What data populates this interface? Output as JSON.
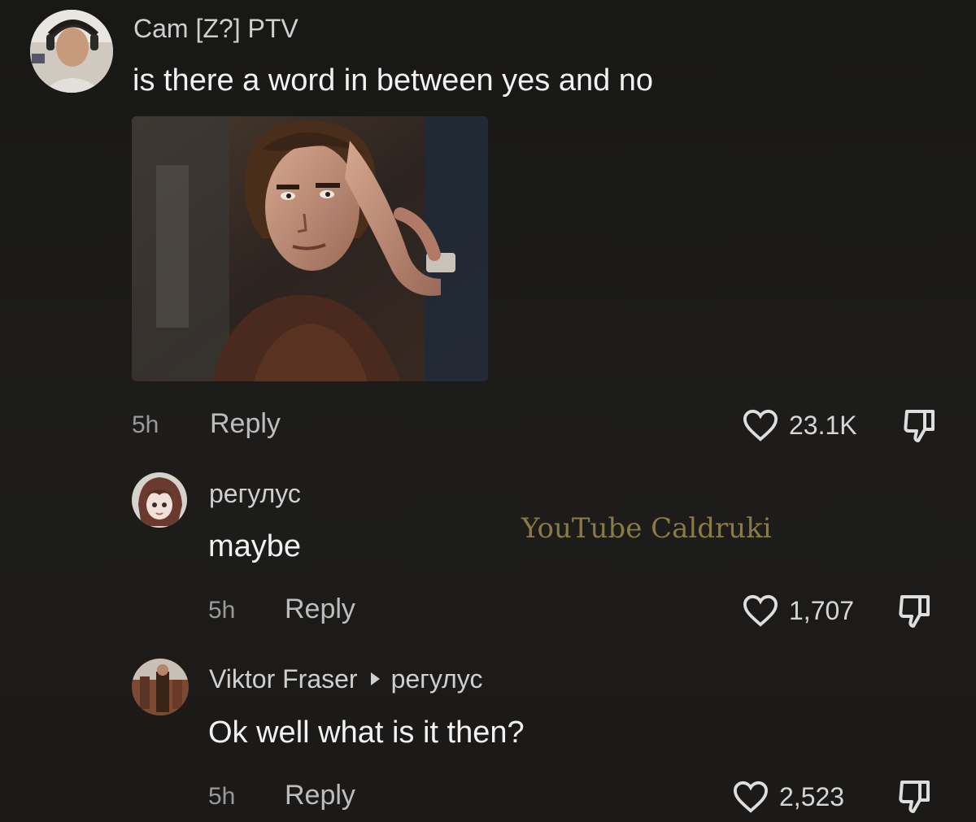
{
  "comments": [
    {
      "author": "Cam [Z?] PTV",
      "text": "is there a word in between yes and no",
      "time": "5h",
      "reply_label": "Reply",
      "likes": "23.1K",
      "image": "cartoon-man-thinking"
    },
    {
      "author": "регулус",
      "text": "maybe",
      "time": "5h",
      "reply_label": "Reply",
      "likes": "1,707"
    },
    {
      "author": "Viktor Fraser",
      "replying_to": "регулус",
      "text": "Ok well what is it then?",
      "time": "5h",
      "reply_label": "Reply",
      "likes": "2,523"
    }
  ],
  "watermark": "YouTube Caldruki",
  "icons": {
    "like": "heart-outline-icon",
    "dislike": "thumbs-down-icon",
    "reply_to": "triangle-right-icon"
  },
  "colors": {
    "background": "#1c1b19",
    "text": "#f2f2f2",
    "muted": "#9a9a9a",
    "watermark": "#8a7a45"
  }
}
